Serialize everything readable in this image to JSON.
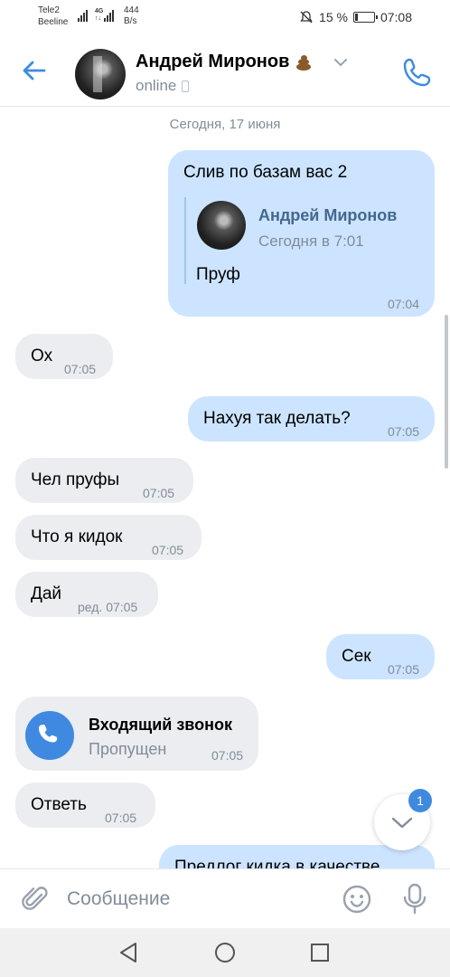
{
  "status_bar": {
    "carrier1": "Tele2",
    "carrier2": "Beeline",
    "net_top": "4G",
    "net_bottom": "↑↓",
    "speed_value": "444",
    "speed_unit": "B/s",
    "battery": "15 %",
    "time": "07:08"
  },
  "header": {
    "contact_name": "Андрей Миронов",
    "status": "online"
  },
  "chat": {
    "date_separator": "Сегодня, 17 июня",
    "messages": [
      {
        "dir": "out",
        "text": "Слив по базам вас 2",
        "time": "07:04"
      },
      {
        "dir": "in",
        "text": "Ох",
        "time": "07:05"
      },
      {
        "dir": "out",
        "text": "Нахуя так делать?",
        "time": "07:05"
      },
      {
        "dir": "in",
        "text": "Чел пруфы",
        "time": "07:05"
      },
      {
        "dir": "in",
        "text": "Что я кидок",
        "time": "07:05"
      },
      {
        "dir": "in",
        "text": "Дай",
        "time": "ред. 07:05"
      },
      {
        "dir": "out",
        "text": "Сек",
        "time": "07:05"
      },
      {
        "dir": "in",
        "text": "Ответь",
        "time": "07:05"
      },
      {
        "dir": "out",
        "text": "Предлог кидка в качестве"
      }
    ],
    "forwarded": {
      "author": "Андрей Миронов",
      "date": "Сегодня в 7:01",
      "text": "Пруф"
    },
    "call": {
      "title": "Входящий звонок",
      "subtitle": "Пропущен",
      "time": "07:05"
    },
    "unread_badge": "1"
  },
  "composer": {
    "placeholder": "Сообщение"
  },
  "colors": {
    "accent": "#3f8ae0",
    "bubble_out": "#cce4ff",
    "bubble_in": "#ebedf0",
    "secondary_text": "#818c99"
  }
}
